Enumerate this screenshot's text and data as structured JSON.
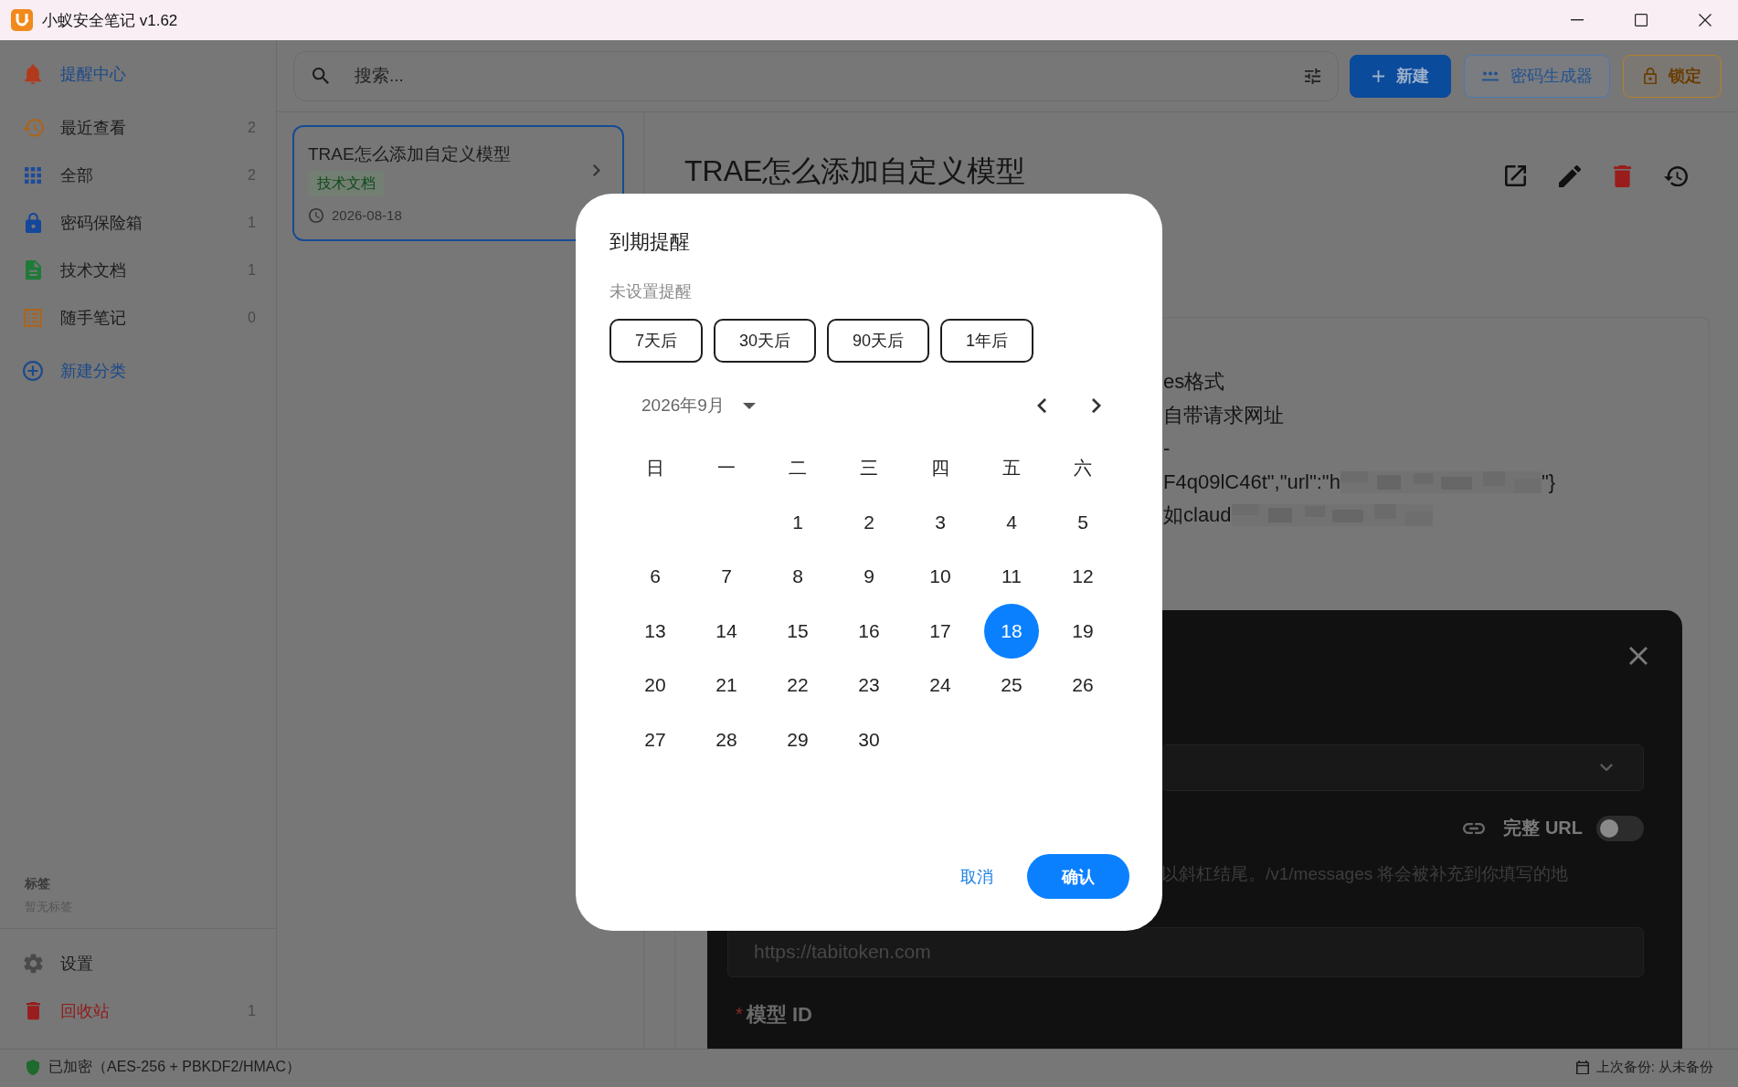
{
  "window": {
    "title": "小蚁安全笔记 v1.62"
  },
  "sidebar": {
    "items": [
      {
        "label": "提醒中心",
        "selected": true
      },
      {
        "label": "最近查看",
        "count": "2",
        "selected": false
      },
      {
        "label": "全部",
        "count": "2",
        "selected": false
      },
      {
        "label": "密码保险箱",
        "count": "1",
        "selected": false
      },
      {
        "label": "技术文档",
        "count": "1",
        "selected": false
      },
      {
        "label": "随手笔记",
        "count": "0",
        "selected": false
      }
    ],
    "new_category": "新建分类",
    "tags": {
      "heading": "标签",
      "empty_text": "暂无标签"
    },
    "footer_items": [
      {
        "label": "设置",
        "kind": "normal"
      },
      {
        "label": "回收站",
        "kind": "danger",
        "count": "1"
      }
    ]
  },
  "toolbar": {
    "search": {
      "placeholder": "搜索..."
    },
    "buttons": [
      {
        "label": "新建",
        "kind": "primary"
      },
      {
        "label": "密码生成器",
        "kind": "secondary"
      },
      {
        "label": "锁定",
        "kind": "warning"
      }
    ]
  },
  "notes": [
    {
      "title": "TRAE怎么添加自定义模型",
      "tag": "技术文档",
      "date": "2026-08-18",
      "selected": true
    }
  ],
  "note": {
    "title": "TRAE怎么添加自定义模型",
    "body_lines": [
      [
        {
          "kind": "text",
          "text": "es格式"
        }
      ],
      [
        {
          "kind": "text",
          "text": "自带请求网址"
        }
      ],
      [
        {
          "kind": "text",
          "text": "-"
        }
      ],
      [
        {
          "kind": "text",
          "text": "F4q09lC46t\",\"url\":\"h"
        },
        {
          "kind": "redacted"
        },
        {
          "kind": "text",
          "text": "\"}"
        }
      ],
      [
        {
          "kind": "text",
          "text": "如claud"
        },
        {
          "kind": "redacted"
        }
      ]
    ],
    "embedded_screenshot": {
      "toggle": {
        "label": "完整 URL",
        "on": false
      },
      "hint": "以斜杠结尾。/v1/messages 将会被补充到你填写的地",
      "url_field": {
        "placeholder": "https://tabitoken.com"
      },
      "field_label": {
        "required_mark": "*",
        "text": "模型 ID"
      }
    }
  },
  "dialog": {
    "title": "到期提醒",
    "status": "未设置提醒",
    "presets": [
      "7天后",
      "30天后",
      "90天后",
      "1年后"
    ],
    "month": "2026年9月",
    "weekdays": [
      "日",
      "一",
      "二",
      "三",
      "四",
      "五",
      "六"
    ],
    "weeks": [
      [
        {
          "kind": "blank"
        },
        {
          "kind": "blank"
        },
        {
          "kind": "day",
          "label": "1",
          "selected": false
        },
        {
          "kind": "day",
          "label": "2",
          "selected": false
        },
        {
          "kind": "day",
          "label": "3",
          "selected": false
        },
        {
          "kind": "day",
          "label": "4",
          "selected": false
        },
        {
          "kind": "day",
          "label": "5",
          "selected": false
        }
      ],
      [
        {
          "kind": "day",
          "label": "6",
          "selected": false
        },
        {
          "kind": "day",
          "label": "7",
          "selected": false
        },
        {
          "kind": "day",
          "label": "8",
          "selected": false
        },
        {
          "kind": "day",
          "label": "9",
          "selected": false
        },
        {
          "kind": "day",
          "label": "10",
          "selected": false
        },
        {
          "kind": "day",
          "label": "11",
          "selected": false
        },
        {
          "kind": "day",
          "label": "12",
          "selected": false
        }
      ],
      [
        {
          "kind": "day",
          "label": "13",
          "selected": false
        },
        {
          "kind": "day",
          "label": "14",
          "selected": false
        },
        {
          "kind": "day",
          "label": "15",
          "selected": false
        },
        {
          "kind": "day",
          "label": "16",
          "selected": false
        },
        {
          "kind": "day",
          "label": "17",
          "selected": false
        },
        {
          "kind": "day",
          "label": "18",
          "selected": true
        },
        {
          "kind": "day",
          "label": "19",
          "selected": false
        }
      ],
      [
        {
          "kind": "day",
          "label": "20",
          "selected": false
        },
        {
          "kind": "day",
          "label": "21",
          "selected": false
        },
        {
          "kind": "day",
          "label": "22",
          "selected": false
        },
        {
          "kind": "day",
          "label": "23",
          "selected": false
        },
        {
          "kind": "day",
          "label": "24",
          "selected": false
        },
        {
          "kind": "day",
          "label": "25",
          "selected": false
        },
        {
          "kind": "day",
          "label": "26",
          "selected": false
        }
      ],
      [
        {
          "kind": "day",
          "label": "27",
          "selected": false
        },
        {
          "kind": "day",
          "label": "28",
          "selected": false
        },
        {
          "kind": "day",
          "label": "29",
          "selected": false
        },
        {
          "kind": "day",
          "label": "30",
          "selected": false
        }
      ]
    ],
    "actions": [
      {
        "label": "取消",
        "kind": "text"
      },
      {
        "label": "确认",
        "kind": "primary"
      }
    ]
  },
  "status_bar": {
    "encryption": "已加密（AES-256 + PBKDF2/HMAC）",
    "backup": "上次备份: 从未备份"
  }
}
